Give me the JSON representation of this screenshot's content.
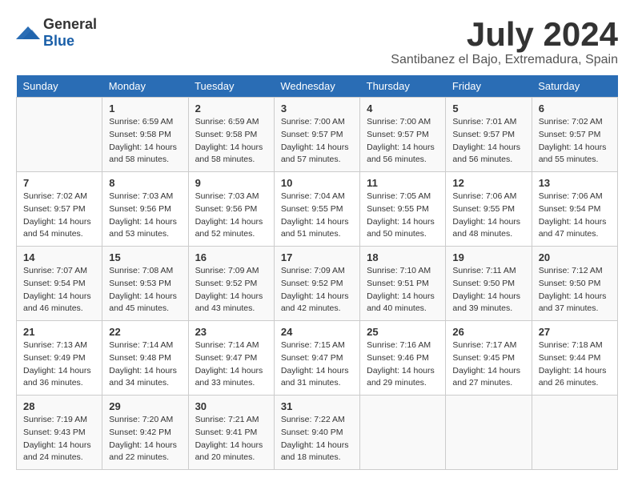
{
  "header": {
    "logo_general": "General",
    "logo_blue": "Blue",
    "main_title": "July 2024",
    "subtitle": "Santibanez el Bajo, Extremadura, Spain"
  },
  "calendar": {
    "days_of_week": [
      "Sunday",
      "Monday",
      "Tuesday",
      "Wednesday",
      "Thursday",
      "Friday",
      "Saturday"
    ],
    "weeks": [
      [
        {
          "day": "",
          "info": ""
        },
        {
          "day": "1",
          "info": "Sunrise: 6:59 AM\nSunset: 9:58 PM\nDaylight: 14 hours\nand 58 minutes."
        },
        {
          "day": "2",
          "info": "Sunrise: 6:59 AM\nSunset: 9:58 PM\nDaylight: 14 hours\nand 58 minutes."
        },
        {
          "day": "3",
          "info": "Sunrise: 7:00 AM\nSunset: 9:57 PM\nDaylight: 14 hours\nand 57 minutes."
        },
        {
          "day": "4",
          "info": "Sunrise: 7:00 AM\nSunset: 9:57 PM\nDaylight: 14 hours\nand 56 minutes."
        },
        {
          "day": "5",
          "info": "Sunrise: 7:01 AM\nSunset: 9:57 PM\nDaylight: 14 hours\nand 56 minutes."
        },
        {
          "day": "6",
          "info": "Sunrise: 7:02 AM\nSunset: 9:57 PM\nDaylight: 14 hours\nand 55 minutes."
        }
      ],
      [
        {
          "day": "7",
          "info": "Sunrise: 7:02 AM\nSunset: 9:57 PM\nDaylight: 14 hours\nand 54 minutes."
        },
        {
          "day": "8",
          "info": "Sunrise: 7:03 AM\nSunset: 9:56 PM\nDaylight: 14 hours\nand 53 minutes."
        },
        {
          "day": "9",
          "info": "Sunrise: 7:03 AM\nSunset: 9:56 PM\nDaylight: 14 hours\nand 52 minutes."
        },
        {
          "day": "10",
          "info": "Sunrise: 7:04 AM\nSunset: 9:55 PM\nDaylight: 14 hours\nand 51 minutes."
        },
        {
          "day": "11",
          "info": "Sunrise: 7:05 AM\nSunset: 9:55 PM\nDaylight: 14 hours\nand 50 minutes."
        },
        {
          "day": "12",
          "info": "Sunrise: 7:06 AM\nSunset: 9:55 PM\nDaylight: 14 hours\nand 48 minutes."
        },
        {
          "day": "13",
          "info": "Sunrise: 7:06 AM\nSunset: 9:54 PM\nDaylight: 14 hours\nand 47 minutes."
        }
      ],
      [
        {
          "day": "14",
          "info": "Sunrise: 7:07 AM\nSunset: 9:54 PM\nDaylight: 14 hours\nand 46 minutes."
        },
        {
          "day": "15",
          "info": "Sunrise: 7:08 AM\nSunset: 9:53 PM\nDaylight: 14 hours\nand 45 minutes."
        },
        {
          "day": "16",
          "info": "Sunrise: 7:09 AM\nSunset: 9:52 PM\nDaylight: 14 hours\nand 43 minutes."
        },
        {
          "day": "17",
          "info": "Sunrise: 7:09 AM\nSunset: 9:52 PM\nDaylight: 14 hours\nand 42 minutes."
        },
        {
          "day": "18",
          "info": "Sunrise: 7:10 AM\nSunset: 9:51 PM\nDaylight: 14 hours\nand 40 minutes."
        },
        {
          "day": "19",
          "info": "Sunrise: 7:11 AM\nSunset: 9:50 PM\nDaylight: 14 hours\nand 39 minutes."
        },
        {
          "day": "20",
          "info": "Sunrise: 7:12 AM\nSunset: 9:50 PM\nDaylight: 14 hours\nand 37 minutes."
        }
      ],
      [
        {
          "day": "21",
          "info": "Sunrise: 7:13 AM\nSunset: 9:49 PM\nDaylight: 14 hours\nand 36 minutes."
        },
        {
          "day": "22",
          "info": "Sunrise: 7:14 AM\nSunset: 9:48 PM\nDaylight: 14 hours\nand 34 minutes."
        },
        {
          "day": "23",
          "info": "Sunrise: 7:14 AM\nSunset: 9:47 PM\nDaylight: 14 hours\nand 33 minutes."
        },
        {
          "day": "24",
          "info": "Sunrise: 7:15 AM\nSunset: 9:47 PM\nDaylight: 14 hours\nand 31 minutes."
        },
        {
          "day": "25",
          "info": "Sunrise: 7:16 AM\nSunset: 9:46 PM\nDaylight: 14 hours\nand 29 minutes."
        },
        {
          "day": "26",
          "info": "Sunrise: 7:17 AM\nSunset: 9:45 PM\nDaylight: 14 hours\nand 27 minutes."
        },
        {
          "day": "27",
          "info": "Sunrise: 7:18 AM\nSunset: 9:44 PM\nDaylight: 14 hours\nand 26 minutes."
        }
      ],
      [
        {
          "day": "28",
          "info": "Sunrise: 7:19 AM\nSunset: 9:43 PM\nDaylight: 14 hours\nand 24 minutes."
        },
        {
          "day": "29",
          "info": "Sunrise: 7:20 AM\nSunset: 9:42 PM\nDaylight: 14 hours\nand 22 minutes."
        },
        {
          "day": "30",
          "info": "Sunrise: 7:21 AM\nSunset: 9:41 PM\nDaylight: 14 hours\nand 20 minutes."
        },
        {
          "day": "31",
          "info": "Sunrise: 7:22 AM\nSunset: 9:40 PM\nDaylight: 14 hours\nand 18 minutes."
        },
        {
          "day": "",
          "info": ""
        },
        {
          "day": "",
          "info": ""
        },
        {
          "day": "",
          "info": ""
        }
      ]
    ]
  }
}
